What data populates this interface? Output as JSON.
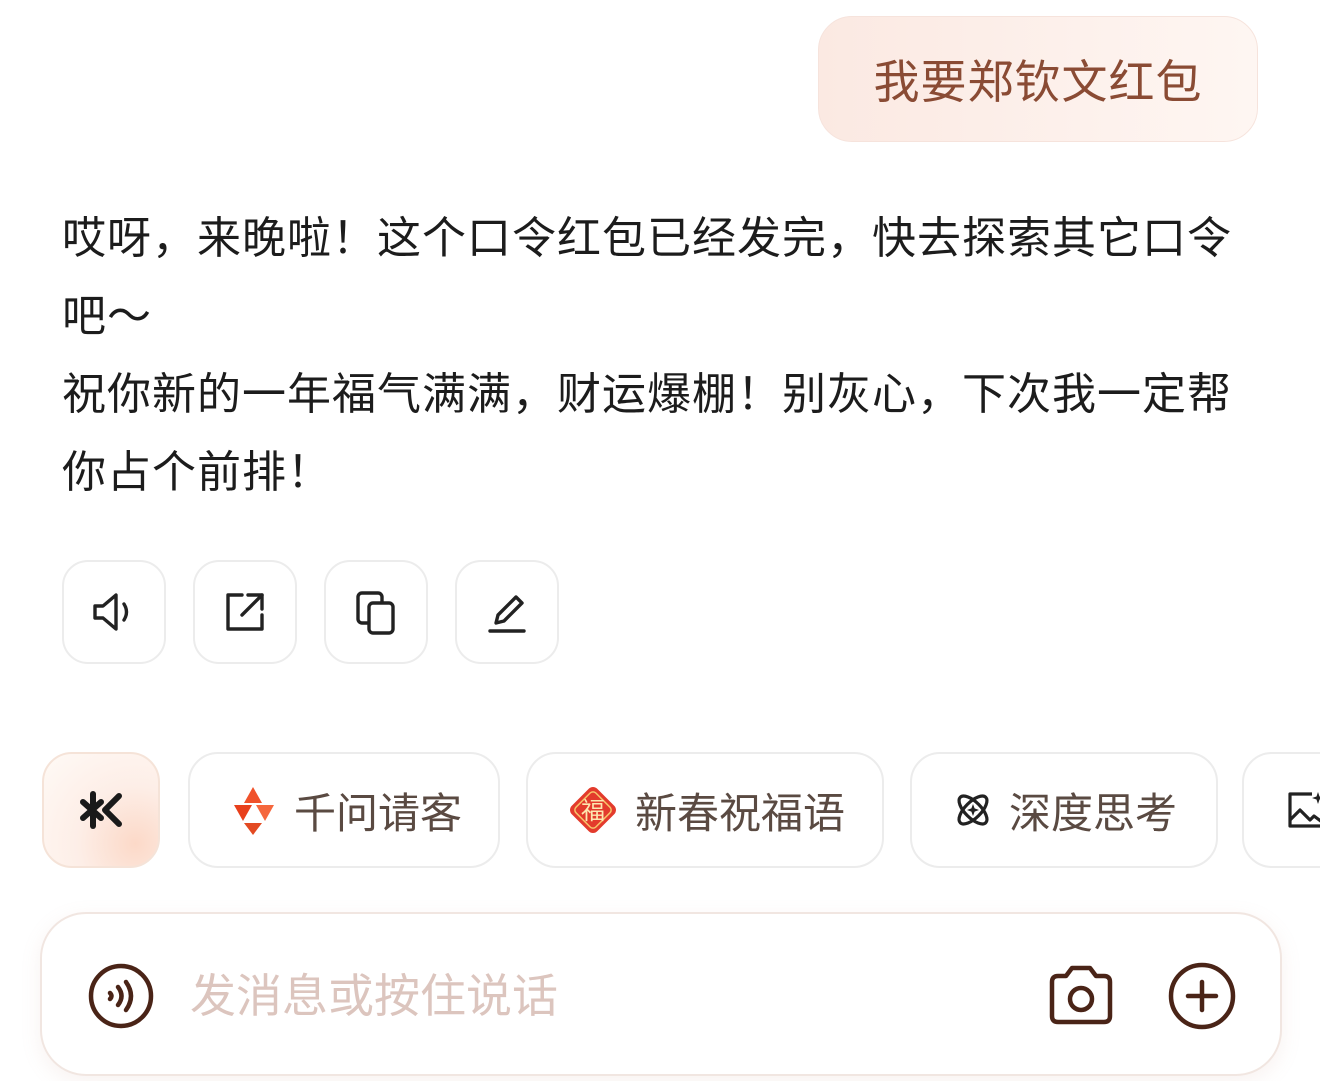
{
  "user_message": {
    "text": "我要郑钦文红包"
  },
  "assistant_reply": {
    "paragraph_1": "哎呀，来晚啦！这个口令红包已经发完，快去探索其它口令吧～",
    "paragraph_2": "祝你新的一年福气满满，财运爆棚！别灰心，下次我一定帮你占个前排！"
  },
  "actions": [
    {
      "icon": "speaker-icon"
    },
    {
      "icon": "share-icon"
    },
    {
      "icon": "copy-icon"
    },
    {
      "icon": "edit-icon"
    }
  ],
  "chips": {
    "spark": {
      "icon": "spark-logo-icon"
    },
    "treat": {
      "icon": "qianwen-logo-icon",
      "label": "千问请客"
    },
    "bless": {
      "icon": "fu-badge-icon",
      "icon_text": "福",
      "label": "新春祝福语"
    },
    "think": {
      "icon": "atom-icon",
      "label": "深度思考"
    },
    "image": {
      "icon": "image-icon"
    }
  },
  "input": {
    "placeholder": "发消息或按住说话",
    "value": ""
  },
  "colors": {
    "accent_brown": "#5a2a1c",
    "bubble_text": "#8a4b34",
    "qianwen_orange": "#f0522b",
    "fu_red": "#e33b2c"
  }
}
